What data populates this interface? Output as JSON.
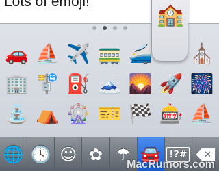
{
  "message": {
    "text": "Lots of emoji!"
  },
  "keyboard": {
    "page_dots": 4,
    "active_page": 1,
    "preview_emoji": "🏫",
    "rows": [
      [
        "🚗",
        "⛵",
        "✈️",
        "🚃",
        "🚄",
        "",
        "⛪"
      ],
      [
        "🏢",
        "🚏",
        "⛽",
        "🗻",
        "🌄",
        "🚀",
        "🎆"
      ],
      [
        "⛲",
        "⛺",
        "🎡",
        "🎫",
        "🏁",
        "🎰",
        "⛵"
      ]
    ]
  },
  "categories": [
    {
      "name": "globe-icon",
      "glyph": "🌐"
    },
    {
      "name": "recent-clock-icon",
      "glyph": "🕓"
    },
    {
      "name": "smiley-icon",
      "glyph": "☺"
    },
    {
      "name": "flower-icon",
      "glyph": "✿"
    },
    {
      "name": "umbrella-icon",
      "glyph": "☂"
    },
    {
      "name": "car-icon",
      "glyph": "🚘",
      "active": true
    },
    {
      "name": "symbols-icon",
      "glyph": "!?#"
    },
    {
      "name": "delete-icon",
      "glyph": "✕"
    }
  ],
  "watermark": "MacRumors.com",
  "colors": {
    "active_category": "#2a6fe0"
  }
}
